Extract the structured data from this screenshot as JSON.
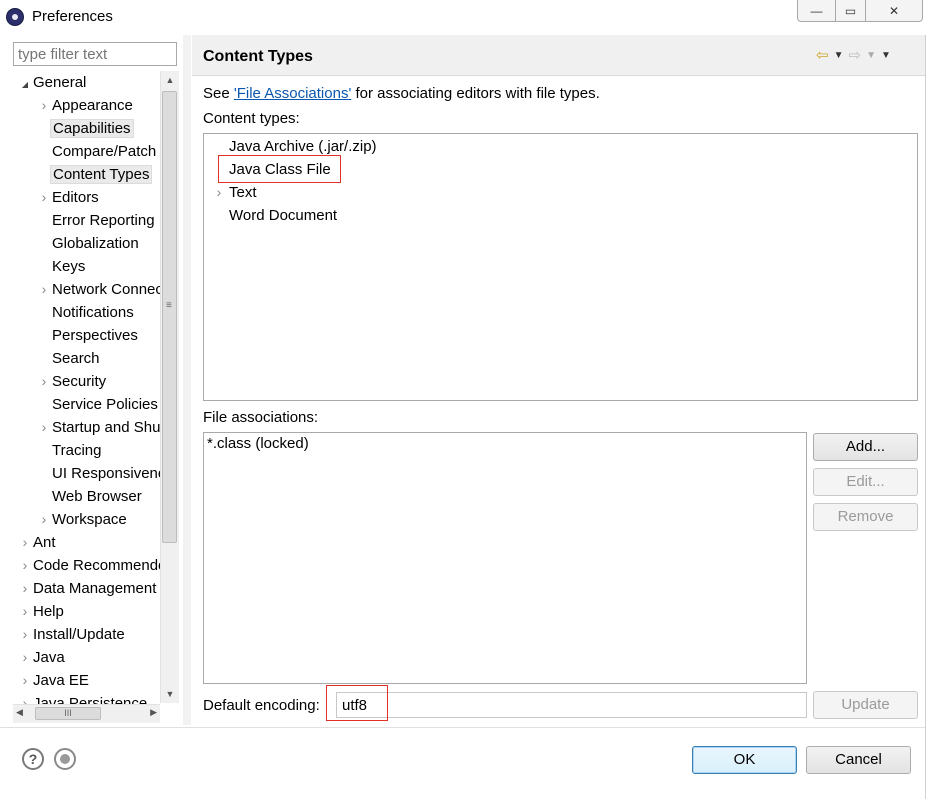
{
  "window": {
    "title": "Preferences",
    "controls": {
      "minimize": "—",
      "maximize": "▭",
      "close": "✕"
    }
  },
  "sidebar": {
    "filter_placeholder": "type filter text",
    "tree": [
      {
        "label": "General",
        "expanded": true,
        "level": 0
      },
      {
        "label": "Appearance",
        "level": 1,
        "has_children": true
      },
      {
        "label": "Capabilities",
        "level": 1,
        "selected_style": true
      },
      {
        "label": "Compare/Patch",
        "level": 1
      },
      {
        "label": "Content Types",
        "level": 1,
        "selected": true
      },
      {
        "label": "Editors",
        "level": 1,
        "has_children": true
      },
      {
        "label": "Error Reporting",
        "level": 1
      },
      {
        "label": "Globalization",
        "level": 1
      },
      {
        "label": "Keys",
        "level": 1
      },
      {
        "label": "Network Connections",
        "level": 1,
        "has_children": true
      },
      {
        "label": "Notifications",
        "level": 1
      },
      {
        "label": "Perspectives",
        "level": 1
      },
      {
        "label": "Search",
        "level": 1
      },
      {
        "label": "Security",
        "level": 1,
        "has_children": true
      },
      {
        "label": "Service Policies",
        "level": 1
      },
      {
        "label": "Startup and Shutdown",
        "level": 1,
        "has_children": true
      },
      {
        "label": "Tracing",
        "level": 1
      },
      {
        "label": "UI Responsiveness",
        "level": 1
      },
      {
        "label": "Web Browser",
        "level": 1
      },
      {
        "label": "Workspace",
        "level": 1,
        "has_children": true
      },
      {
        "label": "Ant",
        "level": 0,
        "has_children": true
      },
      {
        "label": "Code Recommenders",
        "level": 0,
        "has_children": true
      },
      {
        "label": "Data Management",
        "level": 0,
        "has_children": true
      },
      {
        "label": "Help",
        "level": 0,
        "has_children": true
      },
      {
        "label": "Install/Update",
        "level": 0,
        "has_children": true
      },
      {
        "label": "Java",
        "level": 0,
        "has_children": true
      },
      {
        "label": "Java EE",
        "level": 0,
        "has_children": true
      },
      {
        "label": "Java Persistence",
        "level": 0,
        "has_children": true
      }
    ],
    "hscroll_grip": "III",
    "vscroll_grip": "≡"
  },
  "page": {
    "title": "Content Types",
    "see_prefix": "See ",
    "see_link": "'File Associations'",
    "see_suffix": " for associating editors with file types.",
    "content_types_label": "Content types:",
    "content_types": [
      {
        "label": "Java Archive (.jar/.zip)",
        "has_children": false
      },
      {
        "label": "Java Class File",
        "has_children": false,
        "highlighted": true
      },
      {
        "label": "Text",
        "has_children": true
      },
      {
        "label": "Word Document",
        "has_children": false
      }
    ],
    "file_assoc_label": "File associations:",
    "file_associations": [
      "*.class (locked)"
    ],
    "buttons": {
      "add": "Add...",
      "edit": "Edit...",
      "remove": "Remove",
      "update": "Update"
    },
    "encoding_label": "Default encoding:",
    "encoding_value": "utf8"
  },
  "footer": {
    "ok": "OK",
    "cancel": "Cancel",
    "help_glyph": "?"
  },
  "icons": [
    "eclipse-app-icon",
    "back-arrow-icon",
    "forward-arrow-icon",
    "help-icon",
    "record-macro-icon",
    "chevron-right-icon",
    "chevron-down-icon"
  ],
  "colors": {
    "link": "#0a57b0",
    "highlight_box": "#e0302a",
    "ok_border": "#3c7fb1"
  }
}
